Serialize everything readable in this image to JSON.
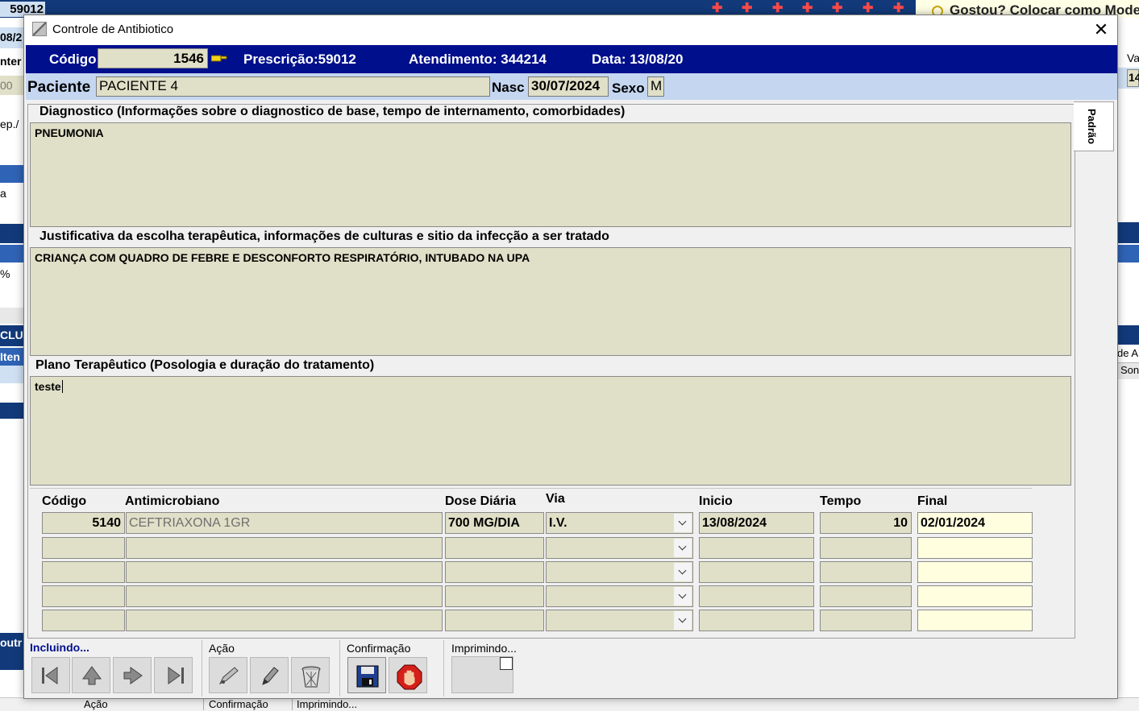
{
  "background": {
    "top_id": "59012",
    "tip_text": "Gostou? Colocar como Mode",
    "left_fragments": [
      "08/2",
      "nter",
      "00",
      "ep./",
      "a",
      "%",
      "CLU",
      "Iten",
      "outr"
    ],
    "right_fragments": [
      "Va",
      "14",
      "de A",
      "Son"
    ],
    "status_labels": [
      "Ação",
      "Confirmação",
      "Imprimindo..."
    ]
  },
  "dialog": {
    "title": "Controle de Antibiotico",
    "close_icon": "close-icon"
  },
  "header": {
    "codigo_label": "Código",
    "codigo_value": "1546",
    "prescricao": "Prescrição:59012",
    "atendimento": "Atendimento: 344214",
    "data": "Data: 13/08/20"
  },
  "patient": {
    "label": "Paciente",
    "name": "PACIENTE 4",
    "nasc_label": "Nasc",
    "nasc_value": "30/07/2024",
    "sexo_label": "Sexo",
    "sexo_value": "M"
  },
  "side_tab": "Padrão",
  "sections": {
    "diagnostico": {
      "title": "Diagnostico (Informações sobre o diagnostico de base, tempo de internamento, comorbidades)",
      "value": "PNEUMONIA"
    },
    "justificativa": {
      "title": "Justificativa da escolha terapêutica, informações de culturas e sitio da infecção a ser tratado",
      "value": "CRIANÇA COM QUADRO DE FEBRE E DESCONFORTO RESPIRATÓRIO, INTUBADO NA UPA"
    },
    "plano": {
      "title": "Plano Terapêutico (Posologia e duração do tratamento)",
      "value": "teste"
    }
  },
  "grid": {
    "headers": {
      "codigo": "Código",
      "antimicrobiano": "Antimicrobiano",
      "dose": "Dose Diária",
      "via": "Via",
      "inicio": "Inicio",
      "tempo": "Tempo",
      "final": "Final"
    },
    "rows": [
      {
        "codigo": "5140",
        "antimicrobiano": "CEFTRIAXONA 1GR",
        "dose": "700 MG/DIA",
        "via": "I.V.",
        "inicio": "13/08/2024",
        "tempo": "10",
        "final": "02/01/2024"
      },
      {
        "codigo": "",
        "antimicrobiano": "",
        "dose": "",
        "via": "",
        "inicio": "",
        "tempo": "",
        "final": ""
      },
      {
        "codigo": "",
        "antimicrobiano": "",
        "dose": "",
        "via": "",
        "inicio": "",
        "tempo": "",
        "final": ""
      },
      {
        "codigo": "",
        "antimicrobiano": "",
        "dose": "",
        "via": "",
        "inicio": "",
        "tempo": "",
        "final": ""
      },
      {
        "codigo": "",
        "antimicrobiano": "",
        "dose": "",
        "via": "",
        "inicio": "",
        "tempo": "",
        "final": ""
      }
    ]
  },
  "bottom": {
    "mode_label": "Incluindo...",
    "acao_label": "Ação",
    "confirmacao_label": "Confirmação",
    "imprimindo_label": "Imprimindo...",
    "colors": {
      "mode": "#000f8c",
      "save": "#1f3f8f",
      "stop": "#d4201a"
    }
  }
}
